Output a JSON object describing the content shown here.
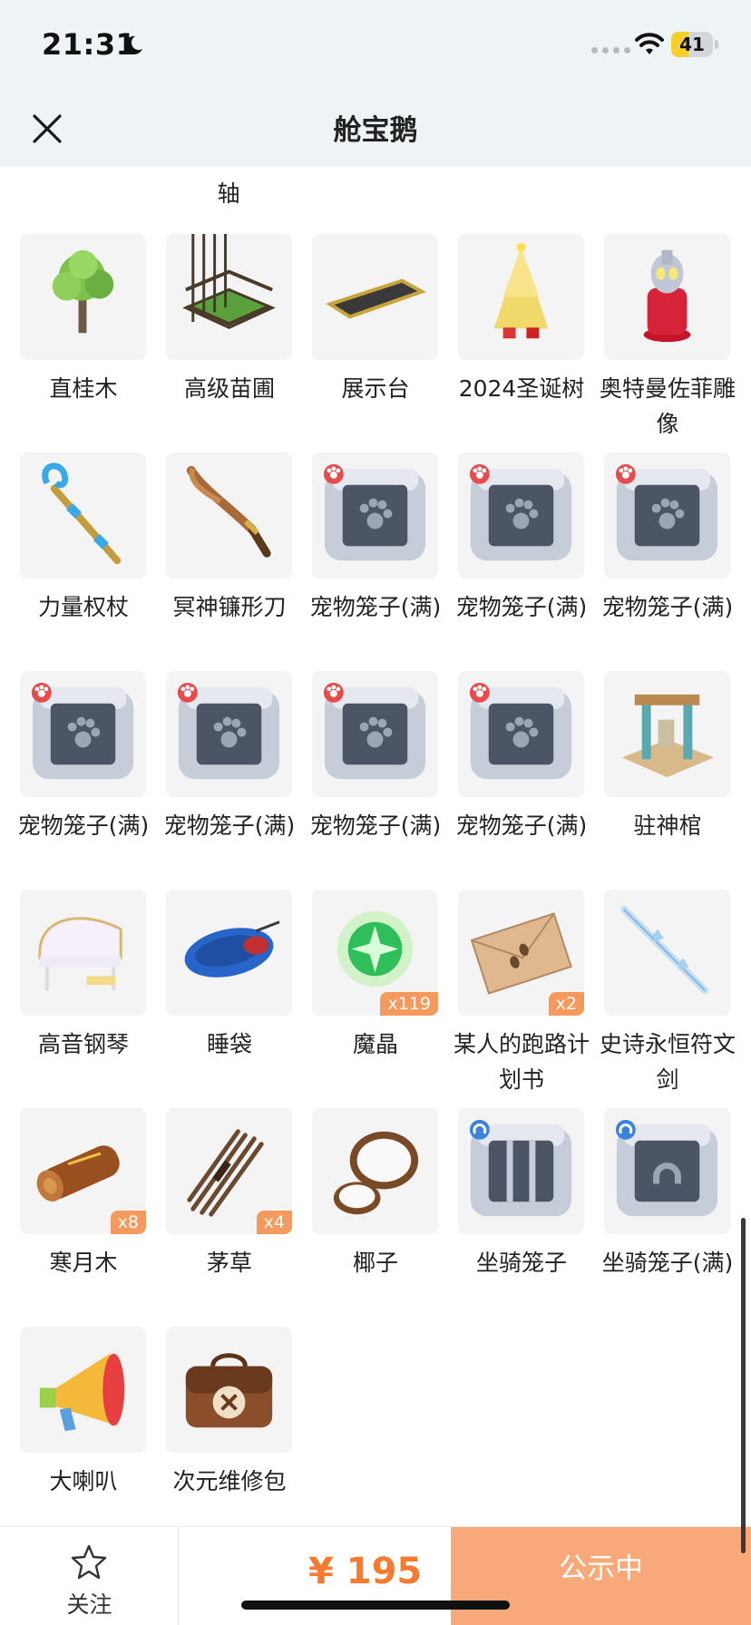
{
  "status": {
    "time": "21:31",
    "battery": "41",
    "battery_level": 0.41
  },
  "nav": {
    "title": "舱宝鹅",
    "close_icon": "close-icon"
  },
  "partial_row": {
    "labels": [
      "轴"
    ]
  },
  "items": [
    {
      "name": "直桂木",
      "icon": "tree-icon"
    },
    {
      "name": "高级苗圃",
      "icon": "nursery-icon"
    },
    {
      "name": "展示台",
      "icon": "display-stand-icon"
    },
    {
      "name": "2024圣诞树",
      "icon": "christmas-tree-icon"
    },
    {
      "name": "奥特曼佐菲雕像",
      "icon": "statue-icon"
    },
    {
      "name": "力量权杖",
      "icon": "scepter-icon"
    },
    {
      "name": "冥神镰形刀",
      "icon": "sickle-sword-icon"
    },
    {
      "name": "宠物笼子(满)",
      "icon": "pet-cage-icon"
    },
    {
      "name": "宠物笼子(满)",
      "icon": "pet-cage-icon"
    },
    {
      "name": "宠物笼子(满)",
      "icon": "pet-cage-icon"
    },
    {
      "name": "宠物笼子(满)",
      "icon": "pet-cage-icon"
    },
    {
      "name": "宠物笼子(满)",
      "icon": "pet-cage-icon"
    },
    {
      "name": "宠物笼子(满)",
      "icon": "pet-cage-icon"
    },
    {
      "name": "宠物笼子(满)",
      "icon": "pet-cage-icon"
    },
    {
      "name": "驻神棺",
      "icon": "shrine-icon"
    },
    {
      "name": "高音钢琴",
      "icon": "piano-icon"
    },
    {
      "name": "睡袋",
      "icon": "sleeping-bag-icon"
    },
    {
      "name": "魔晶",
      "icon": "magic-crystal-icon",
      "qty": "x119"
    },
    {
      "name": "某人的跑路计划书",
      "icon": "envelope-icon",
      "qty": "x2"
    },
    {
      "name": "史诗永恒符文剑",
      "icon": "rune-sword-icon"
    },
    {
      "name": "寒月木",
      "icon": "log-icon",
      "qty": "x8"
    },
    {
      "name": "茅草",
      "icon": "thatch-icon",
      "qty": "x4"
    },
    {
      "name": "椰子",
      "icon": "coconut-icon"
    },
    {
      "name": "坐骑笼子",
      "icon": "mount-cage-icon"
    },
    {
      "name": "坐骑笼子(满)",
      "icon": "mount-cage-full-icon"
    },
    {
      "name": "大喇叭",
      "icon": "megaphone-icon"
    },
    {
      "name": "次元维修包",
      "icon": "repair-bag-icon"
    }
  ],
  "bottom": {
    "follow_label": "关注",
    "follow_icon": "star-icon",
    "price": "¥ 195",
    "cta_label": "公示中"
  }
}
